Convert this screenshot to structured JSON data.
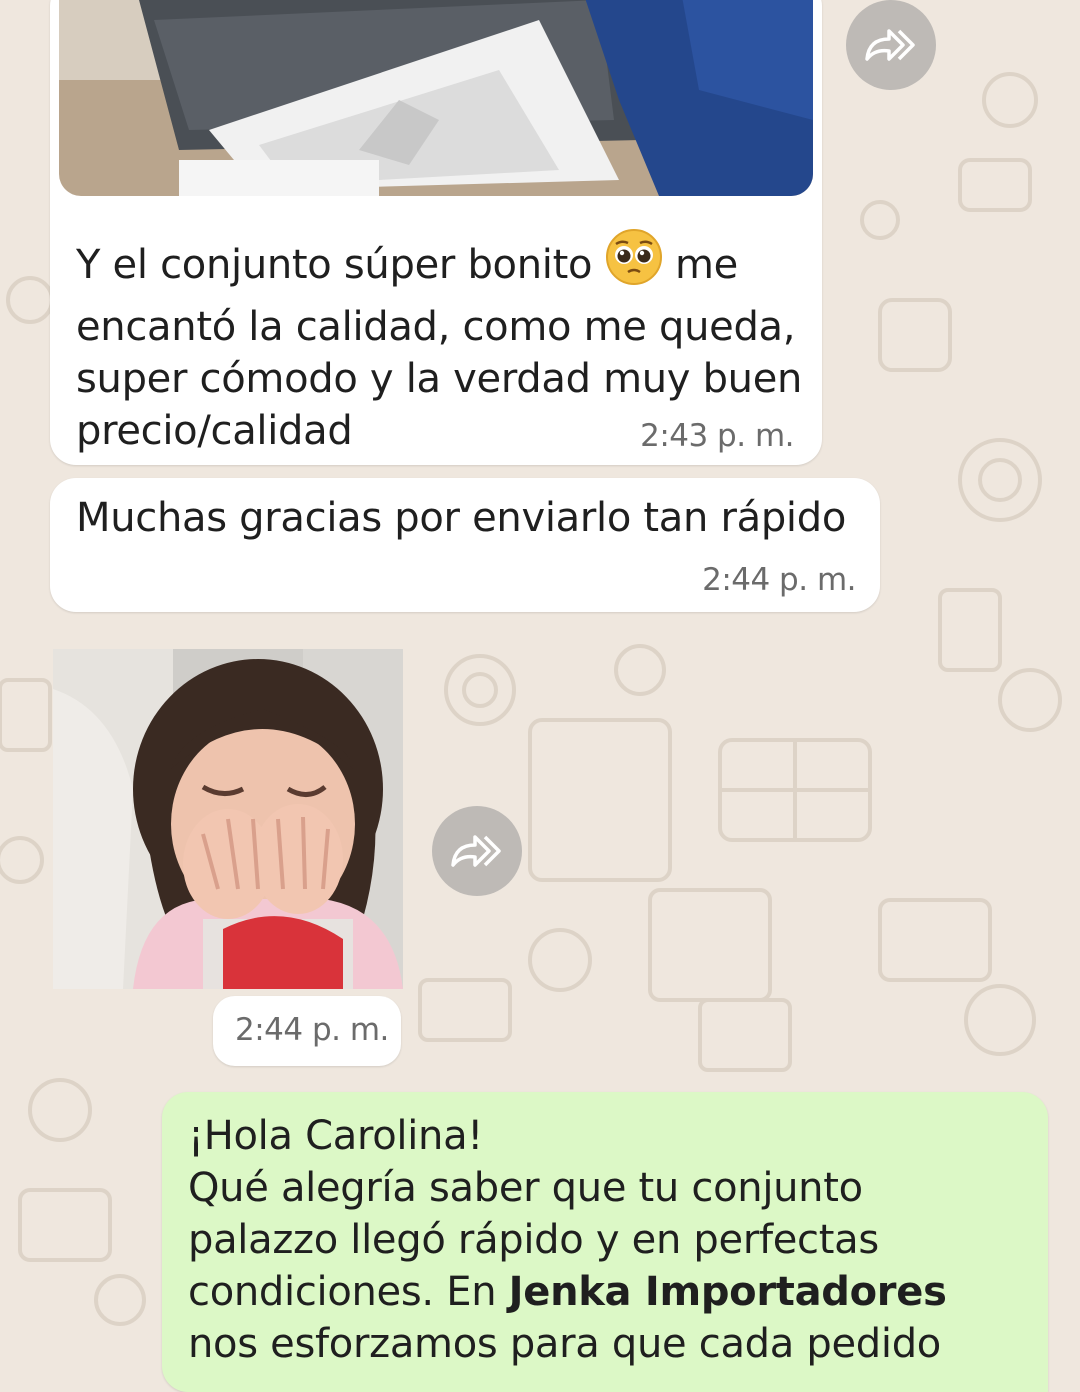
{
  "chat": {
    "msg1": {
      "line1_pre": "Y el conjunto súper bonito",
      "emoji": "pleading-face-emoji",
      "line1_post": "me",
      "line2": "encantó la calidad, como me queda,",
      "line3": "super cómodo y la verdad muy buen",
      "line4": "precio/calidad",
      "time": "2:43 p. m."
    },
    "msg2": {
      "text": "Muchas gracias por enviarlo tan rápido",
      "time": "2:44 p. m."
    },
    "msg3": {
      "image": "crying-girl-photo",
      "time": "2:44 p. m."
    },
    "reply": {
      "line1": "¡Hola Carolina!",
      "line2": "Qué alegría saber que tu conjunto",
      "line3": "palazzo llegó rápido y en perfectas",
      "line4_pre": "condiciones. En ",
      "brand": "Jenka Importadores",
      "line5": "nos esforzamos para que cada pedido"
    }
  },
  "icons": {
    "forward": "forward-icon"
  },
  "colors": {
    "background": "#efe7de",
    "incoming_bubble": "#ffffff",
    "outgoing_bubble": "#dcf8c6",
    "timestamp": "#6b6b6b"
  }
}
